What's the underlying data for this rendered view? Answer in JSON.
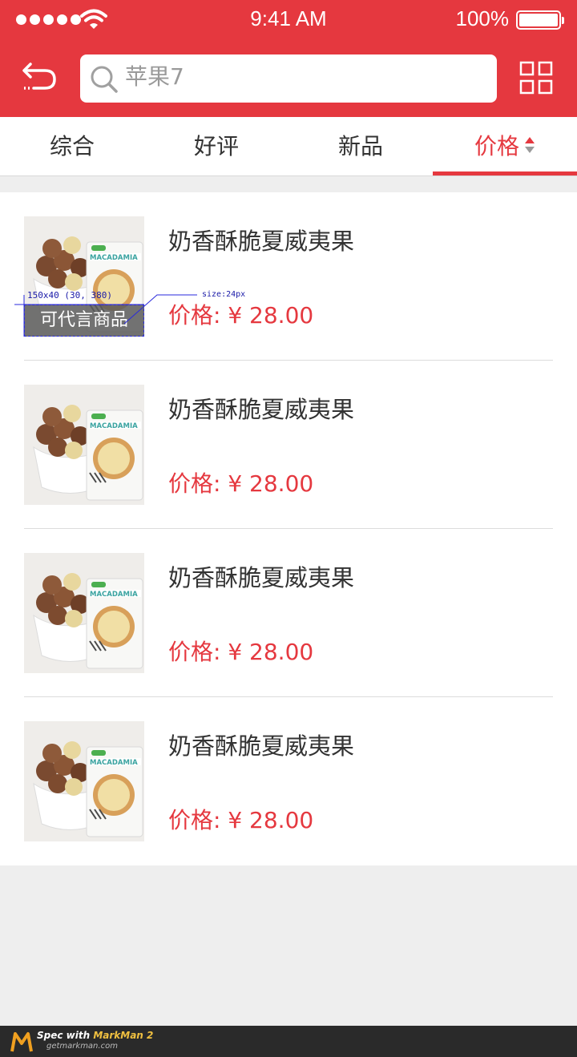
{
  "status_bar": {
    "time": "9:41 AM",
    "battery": "100%"
  },
  "search": {
    "query": "苹果7"
  },
  "tabs": [
    {
      "label": "综合"
    },
    {
      "label": "好评"
    },
    {
      "label": "新品"
    },
    {
      "label": "价格"
    }
  ],
  "products": [
    {
      "name": "奶香酥脆夏威夷果",
      "price": "价格: ¥ 28.00",
      "badge": "可代言商品"
    },
    {
      "name": "奶香酥脆夏威夷果",
      "price": "价格: ¥ 28.00"
    },
    {
      "name": "奶香酥脆夏威夷果",
      "price": "价格: ¥ 28.00"
    },
    {
      "name": "奶香酥脆夏威夷果",
      "price": "价格: ¥ 28.00"
    }
  ],
  "annotations": {
    "box": "150x40 (30, 380)",
    "size": "size:24px"
  },
  "footer": {
    "spec": "Spec with",
    "brand": "MarkMan 2",
    "url": "getmarkman.com"
  },
  "colors": {
    "brand_red": "#e5383f",
    "annotation_blue": "#2a2adc"
  }
}
